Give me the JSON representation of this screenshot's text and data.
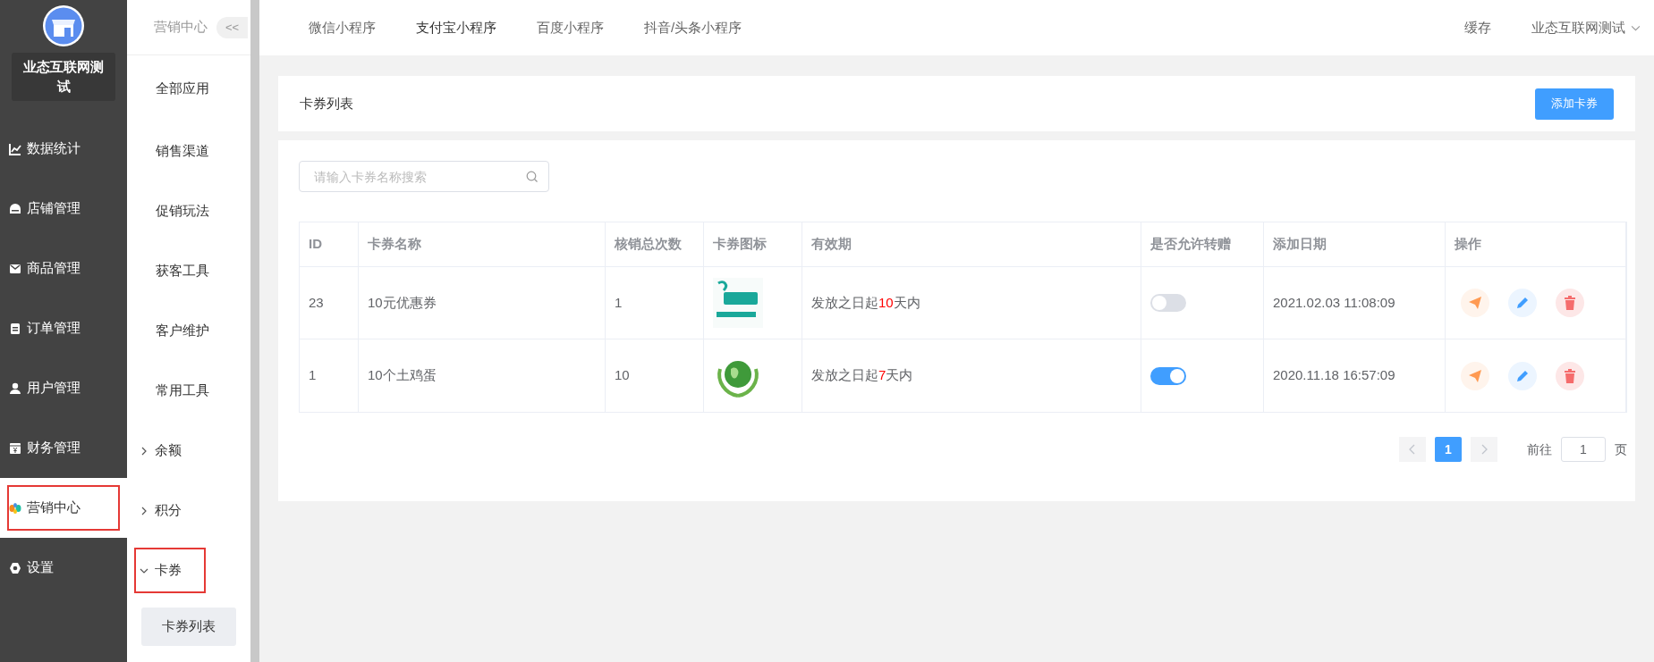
{
  "shop": {
    "name": "业态互联网测试"
  },
  "main_menu": [
    {
      "label": "数据统计",
      "selected": false,
      "highlighted": false
    },
    {
      "label": "店铺管理",
      "selected": false,
      "highlighted": false
    },
    {
      "label": "商品管理",
      "selected": false,
      "highlighted": false
    },
    {
      "label": "订单管理",
      "selected": false,
      "highlighted": false
    },
    {
      "label": "用户管理",
      "selected": false,
      "highlighted": false
    },
    {
      "label": "财务管理",
      "selected": false,
      "highlighted": false
    },
    {
      "label": "营销中心",
      "selected": true,
      "highlighted": true
    },
    {
      "label": "设置",
      "selected": false,
      "highlighted": false
    }
  ],
  "sub_menu": {
    "title": "营销中心",
    "collapse_button": "<<",
    "items": [
      {
        "label": "全部应用",
        "kind": "link",
        "highlighted": false
      },
      {
        "label": "销售渠道",
        "kind": "link",
        "highlighted": false
      },
      {
        "label": "促销玩法",
        "kind": "link",
        "highlighted": false
      },
      {
        "label": "获客工具",
        "kind": "link",
        "highlighted": false
      },
      {
        "label": "客户维护",
        "kind": "link",
        "highlighted": false
      },
      {
        "label": "常用工具",
        "kind": "link",
        "highlighted": false
      },
      {
        "label": "余额",
        "kind": "group",
        "expanded": false,
        "highlighted": false
      },
      {
        "label": "积分",
        "kind": "group",
        "expanded": false,
        "highlighted": false
      },
      {
        "label": "卡券",
        "kind": "group",
        "expanded": true,
        "highlighted": true,
        "children": [
          {
            "label": "卡券列表",
            "selected": true
          }
        ]
      }
    ]
  },
  "top_tabs": [
    {
      "label": "微信小程序",
      "selected": false
    },
    {
      "label": "支付宝小程序",
      "selected": true
    },
    {
      "label": "百度小程序",
      "selected": false
    },
    {
      "label": "抖音/头条小程序",
      "selected": false
    }
  ],
  "top_right": {
    "cache": "缓存",
    "account": "业态互联网测试"
  },
  "page_header": {
    "title": "卡券列表",
    "add_button": "添加卡券"
  },
  "search": {
    "placeholder": "请输入卡券名称搜索"
  },
  "table": {
    "columns": [
      "ID",
      "卡券名称",
      "核销总次数",
      "卡券图标",
      "有效期",
      "是否允许转赠",
      "添加日期",
      "操作"
    ],
    "rows": [
      {
        "id": "23",
        "name": "10元优惠券",
        "redeemed": "1",
        "validity_prefix": "发放之日起",
        "validity_days": "10",
        "validity_suffix": "天内",
        "transferable": false,
        "date": "2021.02.03 11:08:09"
      },
      {
        "id": "1",
        "name": "10个土鸡蛋",
        "redeemed": "10",
        "validity_prefix": "发放之日起",
        "validity_days": "7",
        "validity_suffix": "天内",
        "transferable": true,
        "date": "2020.11.18 16:57:09"
      }
    ]
  },
  "pagination": {
    "current": "1",
    "goto_label": "前往",
    "goto_value": "1",
    "page_unit": "页"
  }
}
